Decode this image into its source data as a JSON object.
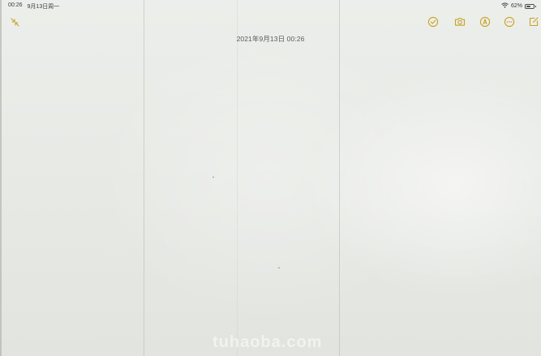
{
  "status_bar": {
    "time": "00:26",
    "date": "9月13日周一",
    "battery_percent": "62%",
    "battery_level": 0.62
  },
  "toolbar": {
    "left_icons": [
      "collapse-arrows-icon"
    ],
    "right_icons": [
      "checklist-icon",
      "camera-icon",
      "markup-pen-icon",
      "more-icon",
      "compose-icon"
    ],
    "accent_color": "#c9a227"
  },
  "note": {
    "date_line": "2021年9月13日 00:26",
    "body": ""
  },
  "watermark": {
    "text": "tuhaoba.com"
  }
}
